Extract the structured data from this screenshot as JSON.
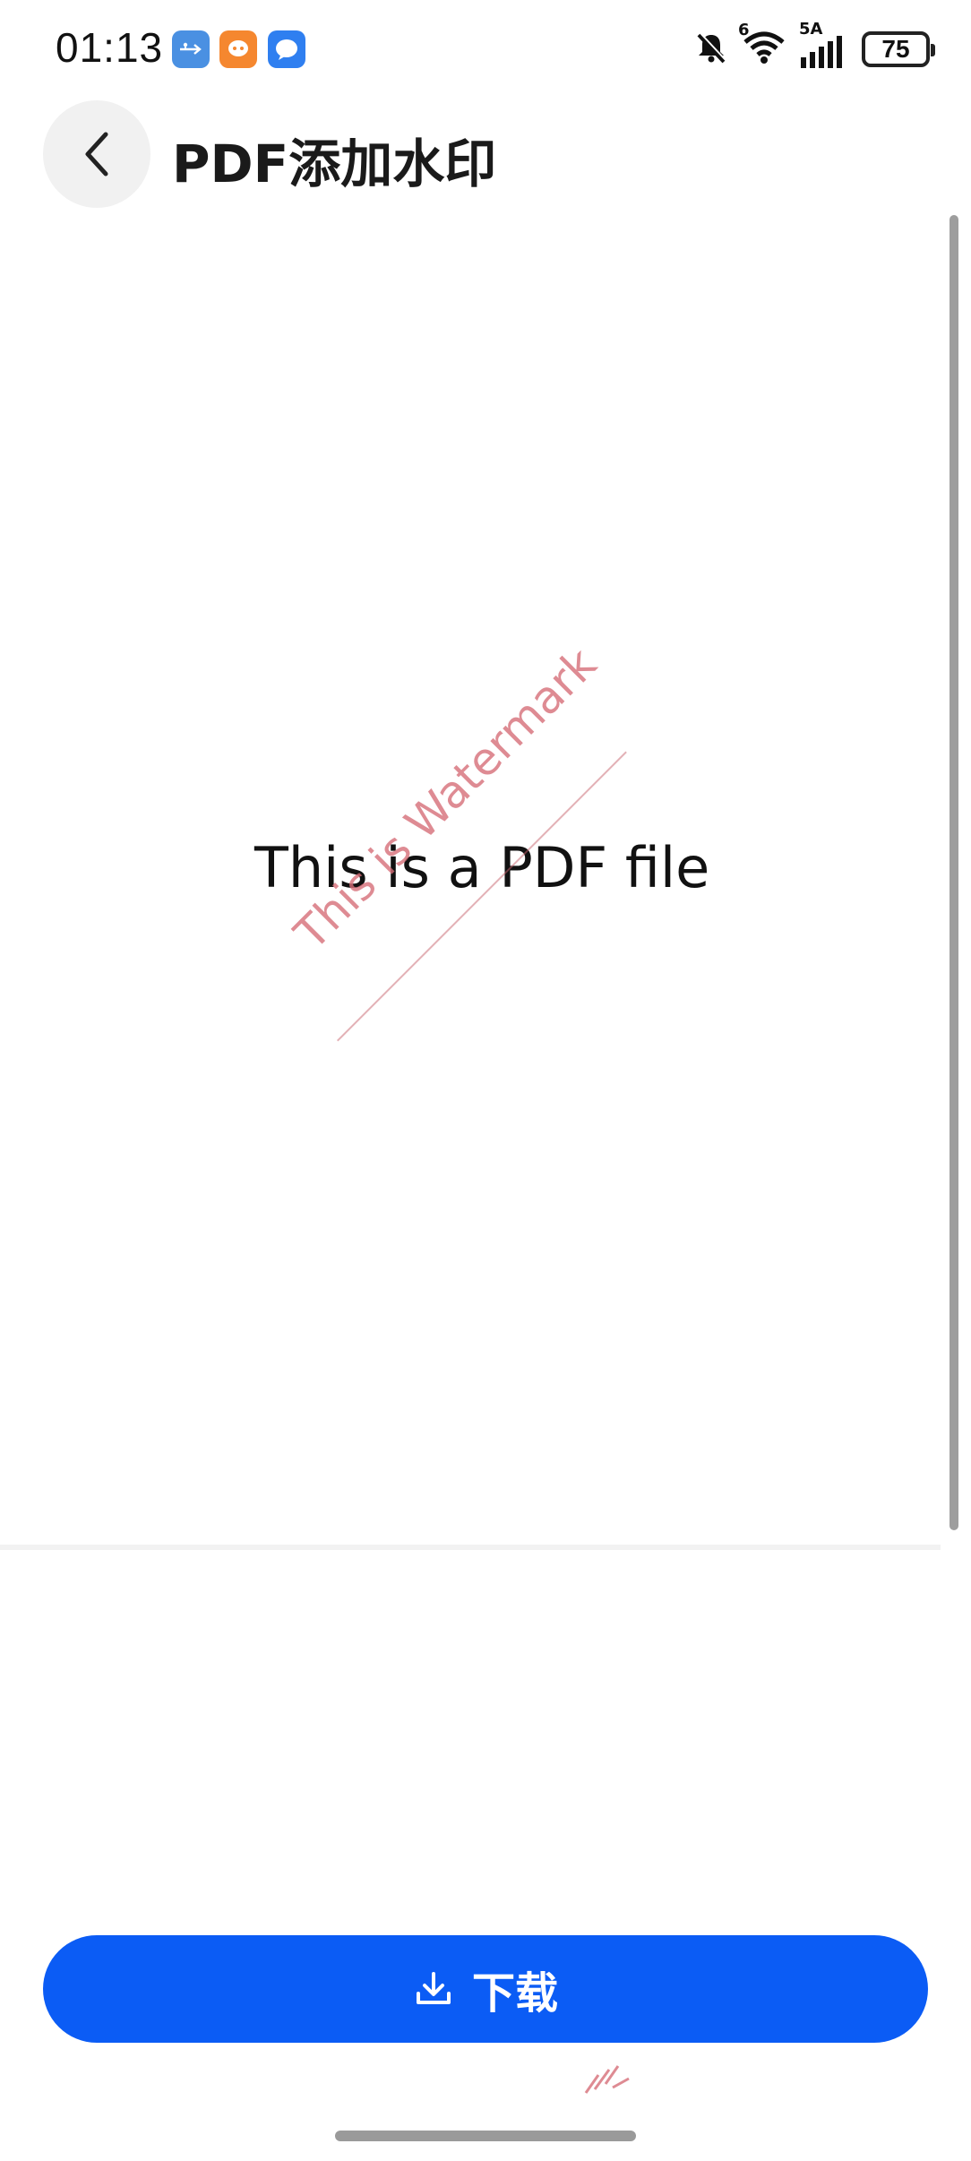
{
  "status_bar": {
    "time": "01:13",
    "battery_level": "75",
    "network_label_top": "6",
    "network_label_5g": "5A",
    "icons": [
      "usb-icon",
      "app-notification-icon",
      "message-icon",
      "mute-bell-icon",
      "wifi-icon",
      "signal-icon",
      "battery-icon"
    ]
  },
  "header": {
    "back_icon": "chevron-left-icon",
    "title": "PDF添加水印"
  },
  "pdf_preview": {
    "body_text": "This is a PDF file",
    "watermark_text": "This is Watermark",
    "watermark_color": "#d66e78"
  },
  "actions": {
    "download_icon": "download-icon",
    "download_label": "下载",
    "accent_color": "#0b5cf5"
  }
}
